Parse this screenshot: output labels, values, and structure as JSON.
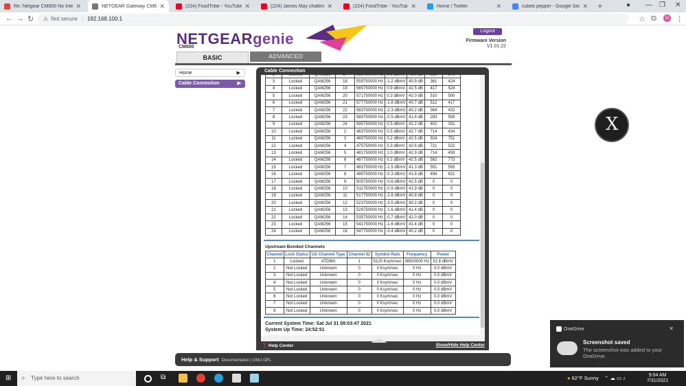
{
  "browser": {
    "tabs": [
      {
        "title": "Re: Netgear CM600 No Internet",
        "color": "#d44"
      },
      {
        "title": "NETGEAR Gateway CM600",
        "color": "#777",
        "active": true
      },
      {
        "title": "(224) FoodTribe - YouTube",
        "color": "#e02"
      },
      {
        "title": "(224) James May challenge",
        "color": "#e02"
      },
      {
        "title": "(224) FoodTribe - YouTube",
        "color": "#e02"
      },
      {
        "title": "Home / Twitter",
        "color": "#1da1f2"
      },
      {
        "title": "cubeb pepper - Google Search",
        "color": "#4285f4"
      }
    ],
    "address": {
      "security": "Not secure",
      "url": "192.168.100.1"
    }
  },
  "router": {
    "brand": "NETGEAR",
    "brand2": "genie",
    "model": "CM600",
    "logout": "Logout",
    "fw_label": "Firmware Version",
    "fw_value": "V1.01.22",
    "tab_basic": "BASIC",
    "tab_advanced": "ADVANCED",
    "side_home": "Home",
    "side_cc": "Cable Connection",
    "panel_title": "Cable Connection",
    "downstream": [
      [
        "2",
        "Locked",
        "QAM256",
        "17",
        "553750000 Hz",
        "0.9 dBmV",
        "43.0 dB",
        "310",
        "376"
      ],
      [
        "3",
        "Locked",
        "QAM256",
        "18",
        "559750000 Hz",
        "-1.2 dBmV",
        "40.9 dB",
        "361",
        "424"
      ],
      [
        "4",
        "Locked",
        "QAM256",
        "19",
        "565750000 Hz",
        "0.9 dBmV",
        "42.5 dB",
        "417",
        "524"
      ],
      [
        "5",
        "Locked",
        "QAM256",
        "20",
        "571750000 Hz",
        "0.3 dBmV",
        "42.0 dB",
        "510",
        "500"
      ],
      [
        "6",
        "Locked",
        "QAM256",
        "21",
        "577750000 Hz",
        "-1.8 dBmV",
        "40.7 dB",
        "512",
        "417"
      ],
      [
        "7",
        "Locked",
        "QAM256",
        "22",
        "583750000 Hz",
        "-2.3 dBmV",
        "40.2 dB",
        "364",
        "432"
      ],
      [
        "8",
        "Locked",
        "QAM256",
        "23",
        "589750000 Hz",
        "-0.5 dBmV",
        "41.6 dB",
        "283",
        "559"
      ],
      [
        "9",
        "Locked",
        "QAM256",
        "24",
        "595750000 Hz",
        "0.5 dBmV",
        "42.2 dB",
        "402",
        "331"
      ],
      [
        "10",
        "Locked",
        "QAM256",
        "2",
        "463750000 Hz",
        "0.5 dBmV",
        "42.7 dB",
        "714",
        "434"
      ],
      [
        "11",
        "Locked",
        "QAM256",
        "3",
        "469750000 Hz",
        "0.2 dBmV",
        "42.5 dB",
        "924",
        "751"
      ],
      [
        "12",
        "Locked",
        "QAM256",
        "4",
        "475750000 Hz",
        "0.3 dBmV",
        "42.6 dB",
        "721",
        "522"
      ],
      [
        "13",
        "Locked",
        "QAM256",
        "5",
        "481750000 Hz",
        "1.0 dBmV",
        "42.9 dB",
        "714",
        "459"
      ],
      [
        "14",
        "Locked",
        "QAM256",
        "6",
        "487750000 Hz",
        "0.2 dBmV",
        "42.5 dB",
        "582",
        "773"
      ],
      [
        "15",
        "Locked",
        "QAM256",
        "7",
        "493750000 Hz",
        "-1.5 dBmV",
        "41.3 dB",
        "551",
        "555"
      ],
      [
        "16",
        "Locked",
        "QAM256",
        "8",
        "499750000 Hz",
        "-0.3 dBmV",
        "41.8 dB",
        "494",
        "621"
      ],
      [
        "17",
        "Locked",
        "QAM256",
        "9",
        "505750000 Hz",
        "-0.6 dBmV",
        "42.5 dB",
        "0",
        "0"
      ],
      [
        "18",
        "Locked",
        "QAM256",
        "10",
        "511750000 Hz",
        "-0.9 dBmV",
        "41.9 dB",
        "0",
        "0"
      ],
      [
        "19",
        "Locked",
        "QAM256",
        "11",
        "517750000 Hz",
        "-2.8 dBmV",
        "40.8 dB",
        "0",
        "0"
      ],
      [
        "20",
        "Locked",
        "QAM256",
        "12",
        "523750000 Hz",
        "-3.5 dBmV",
        "40.2 dB",
        "0",
        "0"
      ],
      [
        "21",
        "Locked",
        "QAM256",
        "13",
        "529750000 Hz",
        "-1.6 dBmV",
        "41.4 dB",
        "0",
        "0"
      ],
      [
        "22",
        "Locked",
        "QAM256",
        "14",
        "535750000 Hz",
        "-0.7 dBmV",
        "42.0 dB",
        "0",
        "0"
      ],
      [
        "23",
        "Locked",
        "QAM256",
        "15",
        "541750000 Hz",
        "-1.6 dBmV",
        "41.4 dB",
        "0",
        "0"
      ],
      [
        "24",
        "Locked",
        "QAM256",
        "16",
        "547750000 Hz",
        "-3.4 dBmV",
        "40.2 dB",
        "0",
        "0"
      ]
    ],
    "upstream_title": "Upstream Bonded Channels",
    "upstream_headers": [
      "Channel",
      "Lock Status",
      "US Channel Type",
      "Channel ID",
      "Symbol Rate",
      "Frequency",
      "Power"
    ],
    "upstream": [
      [
        "1",
        "Locked",
        "ATDMA",
        "1",
        "5120 Ksym/sec",
        "36500000 Hz",
        "51.8 dBmV"
      ],
      [
        "2",
        "Not Locked",
        "Unknown",
        "0",
        "0 Ksym/sec",
        "0 Hz",
        "0.0 dBmV"
      ],
      [
        "3",
        "Not Locked",
        "Unknown",
        "0",
        "0 Ksym/sec",
        "0 Hz",
        "0.0 dBmV"
      ],
      [
        "4",
        "Not Locked",
        "Unknown",
        "0",
        "0 Ksym/sec",
        "0 Hz",
        "0.0 dBmV"
      ],
      [
        "5",
        "Not Locked",
        "Unknown",
        "0",
        "0 Ksym/sec",
        "0 Hz",
        "0.0 dBmV"
      ],
      [
        "6",
        "Not Locked",
        "Unknown",
        "0",
        "0 Ksym/sec",
        "0 Hz",
        "0.0 dBmV"
      ],
      [
        "7",
        "Not Locked",
        "Unknown",
        "0",
        "0 Ksym/sec",
        "0 Hz",
        "0.0 dBmV"
      ],
      [
        "8",
        "Not Locked",
        "Unknown",
        "0",
        "0 Ksym/sec",
        "0 Hz",
        "0.0 dBmV"
      ]
    ],
    "current_time": "Current System Time: Sat Jul 31 08:03:47 2021",
    "up_time": "System Up Time: 24:52:51",
    "help_center": "Help Center",
    "show_hide": "Show/Hide Help Center",
    "footer_title": "Help & Support",
    "footer_links": "Documentation | GNU GPL"
  },
  "toast": {
    "app": "OneDrive",
    "heading": "Screenshot saved",
    "body": "The screenshot was added to your OneDrive."
  },
  "taskbar": {
    "search": "Type here to search",
    "temp": "62°F",
    "weather": "Sunny",
    "time": "9:04 AM",
    "date": "7/31/2021"
  }
}
